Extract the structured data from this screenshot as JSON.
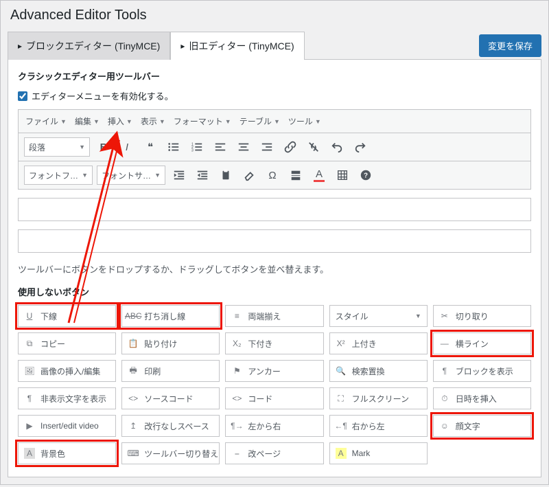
{
  "page": {
    "title": "Advanced Editor Tools"
  },
  "tabs": {
    "block": "ブロックエディター (TinyMCE)",
    "classic": "旧エディター (TinyMCE)"
  },
  "save_button": "変更を保存",
  "section": {
    "classic_toolbar": "クラシックエディター用ツールバー",
    "enable_menu": "エディターメニューを有効化する。"
  },
  "menu": [
    "ファイル",
    "編集",
    "挿入",
    "表示",
    "フォーマット",
    "テーブル",
    "ツール"
  ],
  "toolbar1": {
    "paragraph": "段落"
  },
  "toolbar2": {
    "font_family": "フォントフ…",
    "font_size": "フォントサ…"
  },
  "hint": "ツールバーにボタンをドロップするか、ドラッグしてボタンを並べ替えます。",
  "unused": {
    "label": "使用しないボタン",
    "style_select": "スタイル",
    "items": {
      "underline": "下線",
      "strike": "打ち消し線",
      "justify": "両端揃え",
      "cut": "切り取り",
      "copy": "コピー",
      "paste": "貼り付け",
      "subscript": "下付き",
      "superscript": "上付き",
      "hr": "横ライン",
      "image": "画像の挿入/編集",
      "print": "印刷",
      "anchor": "アンカー",
      "search": "検索置換",
      "blocks": "ブロックを表示",
      "hidden": "非表示文字を表示",
      "source": "ソースコード",
      "code": "コード",
      "fullscreen": "フルスクリーン",
      "datetime": "日時を挿入",
      "video": "Insert/edit video",
      "nbsp": "改行なしスペース",
      "ltr": "左から右",
      "rtl": "右から左",
      "emoji": "顔文字",
      "bgcolor": "背景色",
      "toolbar_toggle": "ツールバー切り替え",
      "pagebreak": "改ページ",
      "mark": "Mark"
    }
  }
}
